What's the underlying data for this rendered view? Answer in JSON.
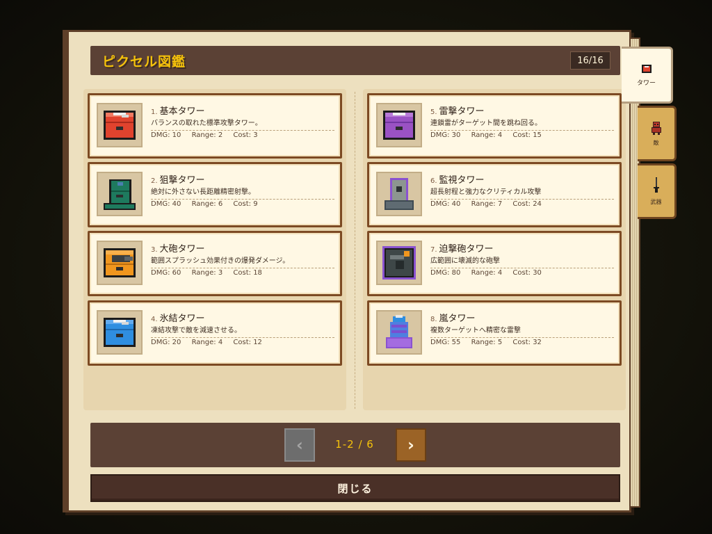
{
  "header": {
    "title": "ピクセル図鑑",
    "counter": "16/16"
  },
  "tabs": [
    {
      "label": "タワー",
      "icon": "tower-icon",
      "active": true
    },
    {
      "label": "敵",
      "icon": "enemy-icon",
      "active": false
    },
    {
      "label": "武器",
      "icon": "weapon-icon",
      "active": false
    }
  ],
  "stat_labels": {
    "dmg": "DMG:",
    "range": "Range:",
    "cost": "Cost:"
  },
  "towers": [
    {
      "num": "1.",
      "name": "基本タワー",
      "desc": "バランスの取れた標準攻撃タワー。",
      "dmg": "10",
      "range": "2",
      "cost": "3",
      "color": "#e0432e"
    },
    {
      "num": "2.",
      "name": "狙撃タワー",
      "desc": "絶対に外さない長距離精密射撃。",
      "dmg": "40",
      "range": "6",
      "cost": "9",
      "color": "#1e7a5e"
    },
    {
      "num": "3.",
      "name": "大砲タワー",
      "desc": "範囲スプラッシュ効果付きの爆発ダメージ。",
      "dmg": "60",
      "range": "3",
      "cost": "18",
      "color": "#f0961e"
    },
    {
      "num": "4.",
      "name": "氷結タワー",
      "desc": "凍結攻撃で敵を減速させる。",
      "dmg": "20",
      "range": "4",
      "cost": "12",
      "color": "#2f8ee0"
    },
    {
      "num": "5.",
      "name": "雷撃タワー",
      "desc": "連鎖雷がターゲット間を跳ね回る。",
      "dmg": "30",
      "range": "4",
      "cost": "15",
      "color": "#9a52c4"
    },
    {
      "num": "6.",
      "name": "監視タワー",
      "desc": "超長射程と強力なクリティカル攻撃",
      "dmg": "40",
      "range": "7",
      "cost": "24",
      "color": "#8d9690"
    },
    {
      "num": "7.",
      "name": "迫撃砲タワー",
      "desc": "広範囲に壊滅的な砲撃",
      "dmg": "80",
      "range": "4",
      "cost": "30",
      "color": "#3e4748"
    },
    {
      "num": "8.",
      "name": "嵐タワー",
      "desc": "複数ターゲットへ精密な雷撃",
      "dmg": "55",
      "range": "5",
      "cost": "32",
      "color": "#7a4fd0"
    }
  ],
  "pager": {
    "label": "1-2 / 6",
    "prev": "‹",
    "next": "›"
  },
  "close_label": "閉じる"
}
